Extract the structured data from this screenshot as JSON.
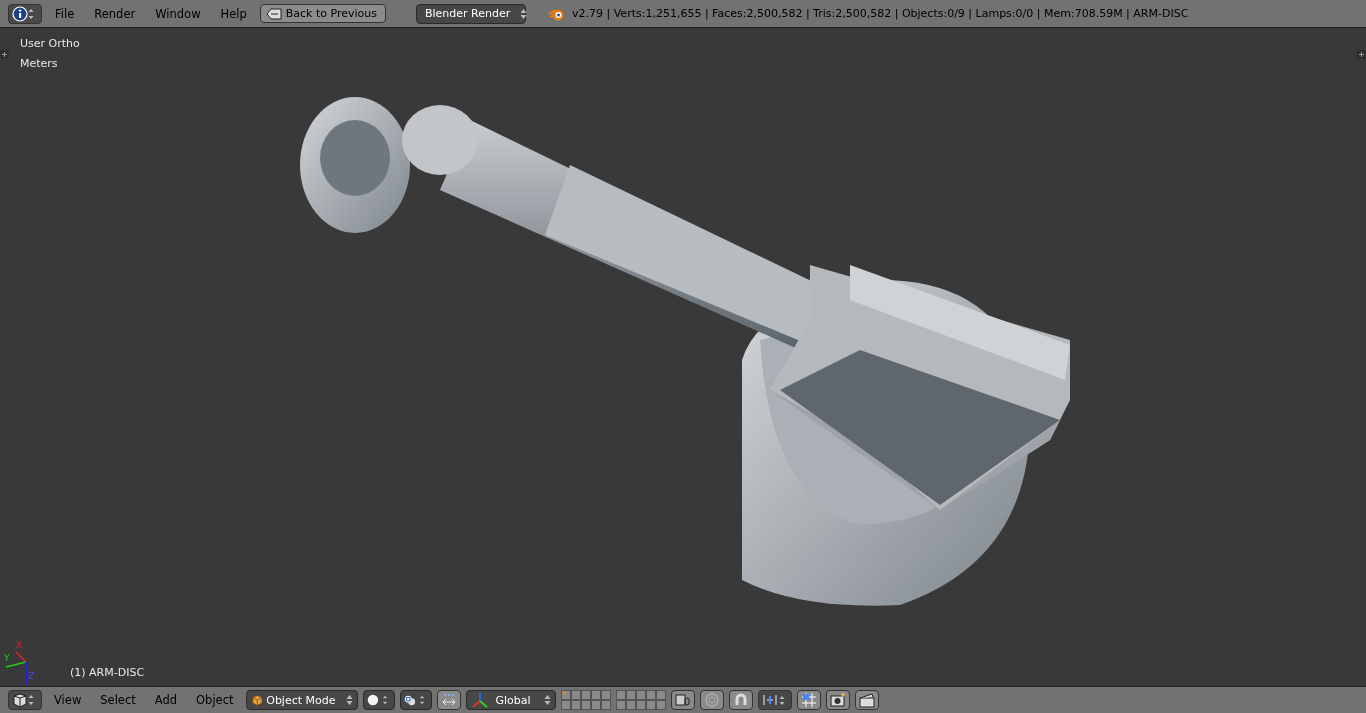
{
  "top_bar": {
    "menus": [
      "File",
      "Render",
      "Window",
      "Help"
    ],
    "back_button": "Back to Previous",
    "render_engine": "Blender Render",
    "stats": "v2.79 | Verts:1,251,655 | Faces:2,500,582 | Tris:2,500,582 | Objects:0/9 | Lamps:0/0 | Mem:708.59M | ARM-DISC"
  },
  "viewport": {
    "view_name": "User Ortho",
    "units": "Meters",
    "object_label": "(1) ARM-DISC",
    "axes": [
      "X",
      "Y",
      "Z"
    ]
  },
  "bottom_bar": {
    "menus": [
      "View",
      "Select",
      "Add",
      "Object"
    ],
    "mode": "Object Mode",
    "orientation": "Global"
  }
}
